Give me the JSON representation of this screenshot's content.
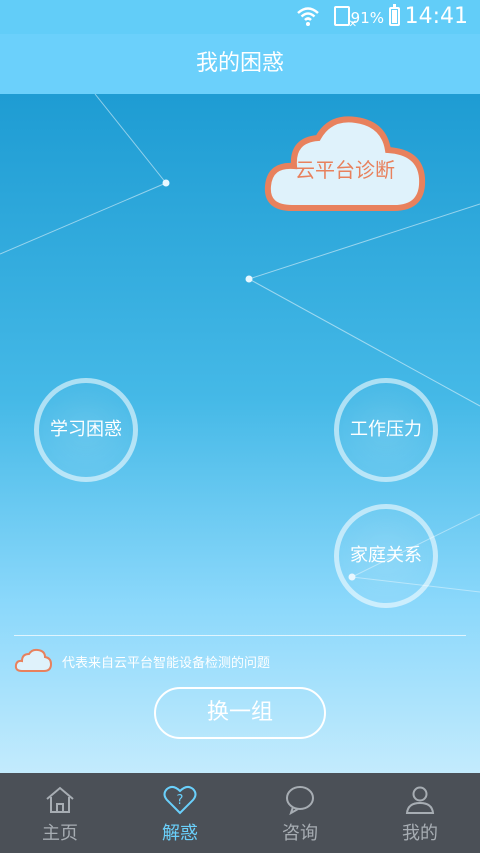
{
  "status_bar": {
    "battery_percent": "91%",
    "time": "14:41"
  },
  "header": {
    "title": "我的困惑"
  },
  "cloud_button": {
    "label": "云平台诊断"
  },
  "topics": [
    "学习困惑",
    "工作压力",
    "家庭关系"
  ],
  "legend": {
    "text": "代表来自云平台智能设备检测的问题"
  },
  "change_button": {
    "label": "换一组"
  },
  "nav": [
    {
      "label": "主页",
      "icon": "home-icon"
    },
    {
      "label": "解惑",
      "icon": "heart-question-icon"
    },
    {
      "label": "咨询",
      "icon": "chat-bubble-icon"
    },
    {
      "label": "我的",
      "icon": "person-icon"
    }
  ],
  "colors": {
    "accent": "#6ad0fb",
    "cloud_orange": "#e8815d",
    "nav_bg": "#4b5057"
  }
}
